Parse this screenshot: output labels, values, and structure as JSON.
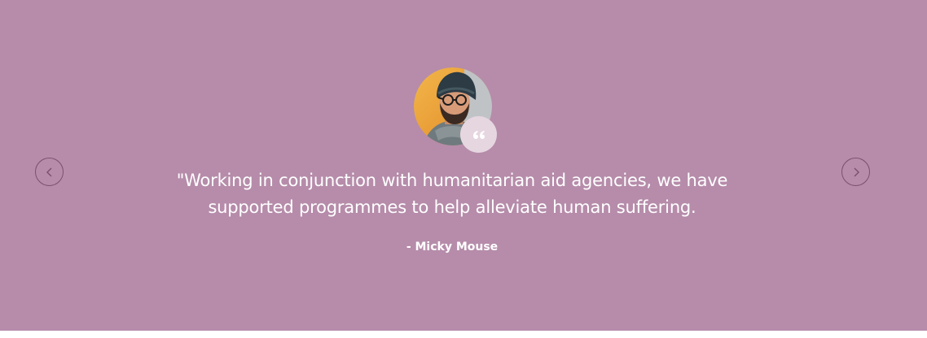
{
  "testimonial": {
    "avatar_icon": "person-portrait",
    "quote_icon": "quote-icon",
    "quote": "\"Working in conjunction with humanitarian aid agencies, we have supported programmes to help alleviate human suffering.",
    "author": "- Micky Mouse"
  },
  "navigation": {
    "prev_icon": "chevron-left-icon",
    "next_icon": "chevron-right-icon"
  },
  "colors": {
    "background": "#b68caa",
    "quote_badge": "#e6d6e0",
    "nav_border": "#7c4e6e",
    "text": "#ffffff"
  }
}
